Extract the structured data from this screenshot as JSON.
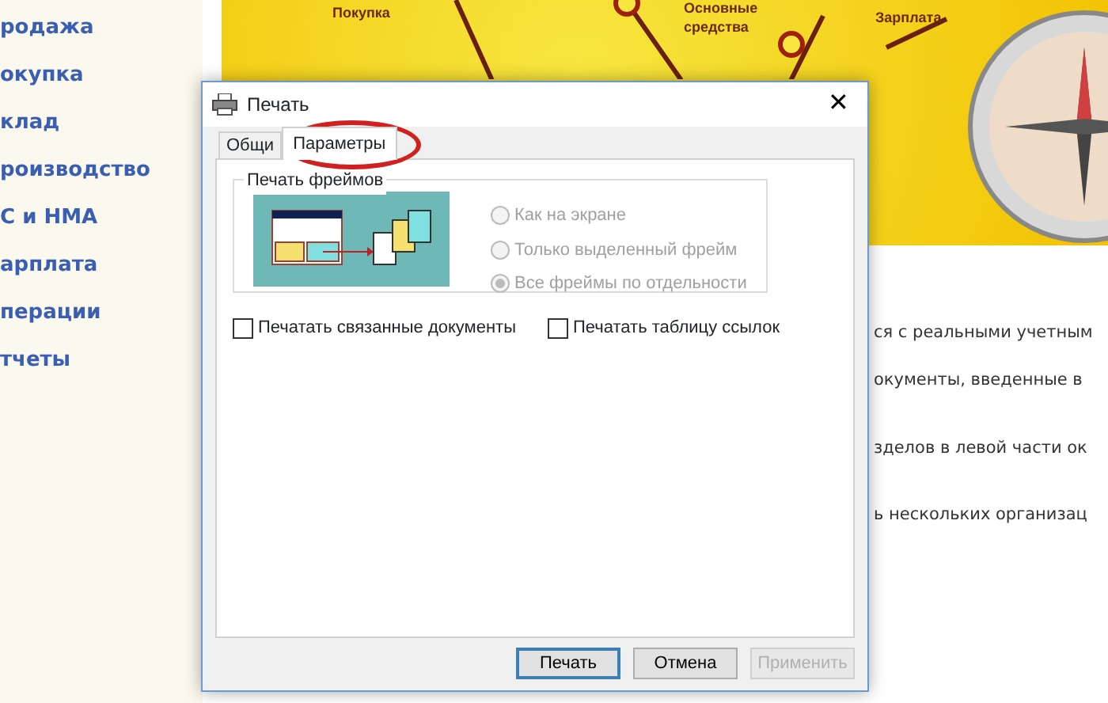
{
  "sidebar": {
    "items": [
      {
        "label": "родажа"
      },
      {
        "label": "окупка"
      },
      {
        "label": "клад"
      },
      {
        "label": "роизводство"
      },
      {
        "label": "С и НМА"
      },
      {
        "label": "арплата"
      },
      {
        "label": "перации"
      },
      {
        "label": "тчеты"
      }
    ]
  },
  "banner": {
    "labels": [
      "Покупка",
      "Основные",
      "средства",
      "Зарплата"
    ]
  },
  "page_text": [
    "ся с реальными учетным",
    "окументы, введенные в",
    "зделов в левой части ок",
    "ь нескольких организац"
  ],
  "dialog": {
    "title": "Печать",
    "close_glyph": "✕",
    "tabs": [
      {
        "label": "Общи",
        "selected": false
      },
      {
        "label": "Параметры",
        "selected": true
      }
    ],
    "group": {
      "title": "Печать фреймов",
      "disabled": true,
      "options": [
        {
          "label": "Как на экране",
          "selected": false
        },
        {
          "label": "Только выделенный фрейм",
          "selected": false
        },
        {
          "label": "Все фреймы по отдельности",
          "selected": true
        }
      ]
    },
    "checkboxes": [
      {
        "label": "Печатать связанные документы",
        "checked": false
      },
      {
        "label": "Печатать таблицу ссылок",
        "checked": false
      }
    ],
    "buttons": [
      {
        "label": "Печать",
        "default": true,
        "disabled": false
      },
      {
        "label": "Отмена",
        "default": false,
        "disabled": false
      },
      {
        "label": "Применить",
        "default": false,
        "disabled": true
      }
    ]
  }
}
